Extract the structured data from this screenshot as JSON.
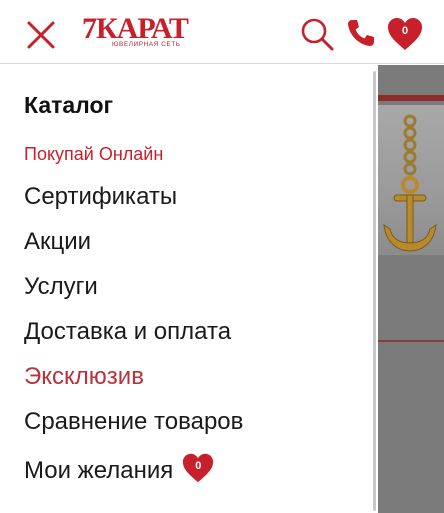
{
  "header": {
    "logo_mark": "7КАРАТ",
    "logo_sub": "ЮВЕЛИРНАЯ СЕТЬ",
    "wishlist_count": "0"
  },
  "menu": {
    "items": [
      {
        "label": "Каталог"
      },
      {
        "label": "Покупай Онлайн"
      },
      {
        "label": "Сертификаты"
      },
      {
        "label": "Акции"
      },
      {
        "label": "Услуги"
      },
      {
        "label": "Доставка и оплата"
      },
      {
        "label": "Эксклюзив"
      },
      {
        "label": "Сравнение товаров"
      },
      {
        "label": "Мои желания",
        "badge": "0"
      }
    ]
  },
  "colors": {
    "brand_red": "#c7202b",
    "accent_exclusive": "#b8323a",
    "text": "#1a1a1a"
  },
  "icons": {
    "close": "close-icon",
    "search": "search-icon",
    "phone": "phone-icon",
    "wishlist": "heart-icon"
  }
}
